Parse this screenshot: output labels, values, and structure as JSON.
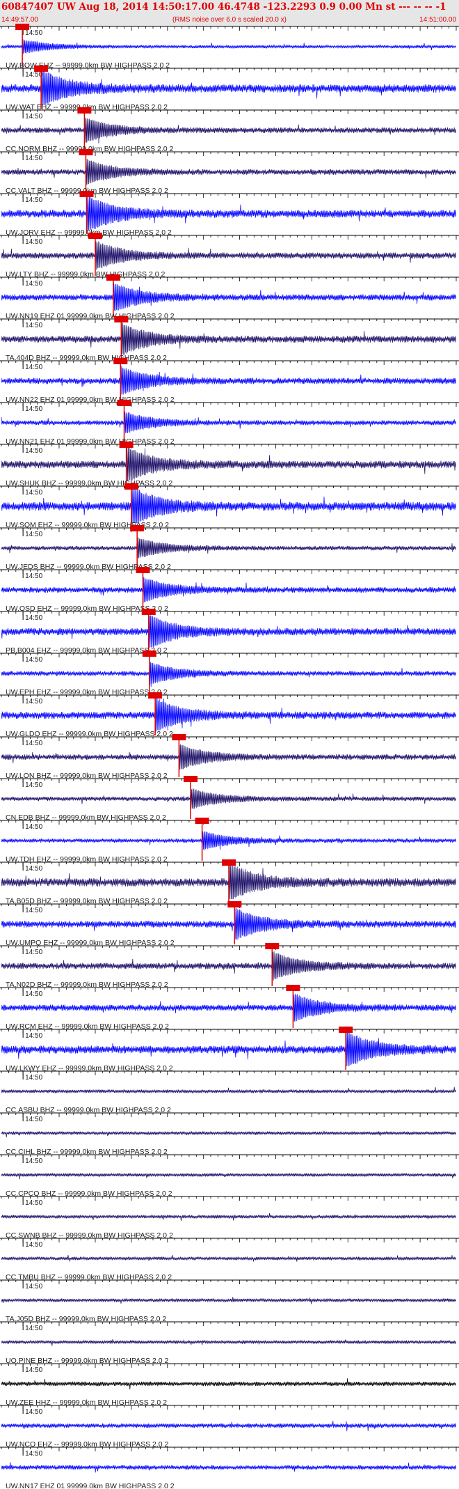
{
  "header": {
    "title": "60847407 UW Aug 18, 2014 14:50:17.00   46.4748 -123.2293  0.9 0.00 Mn st --- -- --  -1",
    "subtitle": "(RMS noise over 6.0 s scaled 20.0 x)",
    "start_time": "14:49:57.00",
    "end_time": "14:51:00.00"
  },
  "colors": {
    "header_bg": "#e6e6e6",
    "header_text": "#e00000",
    "pick": "#e00000",
    "trace_blue": "#0000ff",
    "trace_navy": "#1a0d66",
    "label": "#202020"
  },
  "minute_tick_label": "14:50",
  "chart_data": {
    "type": "line",
    "title": "60847407 UW Aug 18, 2014 14:50:17.00",
    "x_range": [
      "14:49:57.00",
      "14:51:00.00"
    ],
    "x_ticks": [
      "14:50"
    ],
    "series": [
      {
        "name": "UW.BOW EHZ -- 99999.0km BW  HIGHPASS  2.0  2",
        "color": "blue",
        "pick_time": "14:49:59.9",
        "level": 0.15
      },
      {
        "name": "UW.WAT EHZ -- 99999.0km BW  HIGHPASS  2.0  2",
        "color": "blue",
        "pick_time": "14:50:02.5",
        "level": 0.9
      },
      {
        "name": "CC.NORM BHZ -- 99999.0km BW  HIGHPASS  2.0  2",
        "color": "navy",
        "pick_time": "14:50:08.5",
        "level": 0.5
      },
      {
        "name": "CC.VALT BHZ -- 99999.0km BW  HIGHPASS  2.0  2",
        "color": "navy",
        "pick_time": "14:50:08.7",
        "level": 0.5
      },
      {
        "name": "UW.JORV EHZ -- 99999.0km BW  HIGHPASS  2.0  2",
        "color": "blue",
        "pick_time": "14:50:08.8",
        "level": 0.85
      },
      {
        "name": "UW.LTY BHZ -- 99999.0km BW  HIGHPASS  2.0  2",
        "color": "navy",
        "pick_time": "14:50:10.0",
        "level": 0.6
      },
      {
        "name": "UW.NN19 EHZ 01 99999.0km BW  HIGHPASS  2.0  2",
        "color": "blue",
        "pick_time": "14:50:12.5",
        "level": 0.6
      },
      {
        "name": "TA.404D BHZ -- 99999.0km BW  HIGHPASS  2.0  2",
        "color": "navy",
        "pick_time": "14:50:13.6",
        "level": 0.7
      },
      {
        "name": "UW.NN22 EHZ 01 99999.0km BW  HIGHPASS  2.0  2",
        "color": "blue",
        "pick_time": "14:50:13.5",
        "level": 0.6
      },
      {
        "name": "UW.NN21 EHZ 01 99999.0km BW  HIGHPASS  2.0  2",
        "color": "blue",
        "pick_time": "14:50:14.0",
        "level": 0.4
      },
      {
        "name": "UW.SHUK BHZ -- 99999.0km BW  HIGHPASS  2.0  2",
        "color": "navy",
        "pick_time": "14:50:14.3",
        "level": 0.8
      },
      {
        "name": "UW.SQM EHZ -- 99999.0km BW  HIGHPASS  2.0  2",
        "color": "blue",
        "pick_time": "14:50:15.0",
        "level": 0.95
      },
      {
        "name": "UW.JEDS BHZ -- 99999.0km BW  HIGHPASS  2.0  2",
        "color": "navy",
        "pick_time": "14:50:15.8",
        "level": 0.35
      },
      {
        "name": "UW.OSD EHZ -- 99999.0km BW  HIGHPASS  2.0  2",
        "color": "blue",
        "pick_time": "14:50:16.6",
        "level": 0.5
      },
      {
        "name": "PB.B004 EHZ -- 99999.0km BW  HIGHPASS  2.0  2",
        "color": "blue",
        "pick_time": "14:50:17.4",
        "level": 0.75
      },
      {
        "name": "UW.EPH EHZ -- 99999.0km BW  HIGHPASS  2.0  2",
        "color": "blue",
        "pick_time": "14:50:17.5",
        "level": 0.4
      },
      {
        "name": "UW.GLDO EHZ -- 99999.0km BW  HIGHPASS  2.0  2",
        "color": "blue",
        "pick_time": "14:50:18.3",
        "level": 0.75
      },
      {
        "name": "UW.LON BHZ -- 99999.0km BW  HIGHPASS  2.0  2",
        "color": "navy",
        "pick_time": "14:50:21.6",
        "level": 0.5
      },
      {
        "name": "CN.EDB BHZ -- 99999.0km BW  HIGHPASS  2.0  2",
        "color": "navy",
        "pick_time": "14:50:23.2",
        "level": 0.35
      },
      {
        "name": "UW.TDH EHZ -- 99999.0km BW  HIGHPASS  2.0  2",
        "color": "blue",
        "pick_time": "14:50:24.8",
        "level": 0.3
      },
      {
        "name": "TA.B05D BHZ -- 99999.0km BW  HIGHPASS  2.0  2",
        "color": "navy",
        "pick_time": "14:50:28.5",
        "level": 0.9
      },
      {
        "name": "UW.UMPQ EHZ -- 99999.0km BW  HIGHPASS  2.0  2",
        "color": "blue",
        "pick_time": "14:50:29.3",
        "level": 0.7
      },
      {
        "name": "TA.N02D BHZ -- 99999.0km BW  HIGHPASS  2.0  2",
        "color": "navy",
        "pick_time": "14:50:34.5",
        "level": 0.6
      },
      {
        "name": "UW.RCM EHZ -- 99999.0km BW  HIGHPASS  2.0  2",
        "color": "blue",
        "pick_time": "14:50:37.4",
        "level": 0.6
      },
      {
        "name": "UW.LKWY EHZ -- 99999.0km BW  HIGHPASS  2.0  2",
        "color": "blue",
        "pick_time": "14:50:44.7",
        "level": 0.85
      },
      {
        "name": "CC.ASBU BHZ -- 99999.0km BW  HIGHPASS  2.0  2",
        "color": "navy",
        "level": 0.2
      },
      {
        "name": "CC.CIHL BHZ -- 99999.0km BW  HIGHPASS  2.0  2",
        "color": "navy",
        "level": 0.2
      },
      {
        "name": "CC.CPCO BHZ -- 99999.0km BW  HIGHPASS  2.0  2",
        "color": "navy",
        "level": 0.2
      },
      {
        "name": "CC.SWNB BHZ -- 99999.0km BW  HIGHPASS  2.0  2",
        "color": "navy",
        "level": 0.2
      },
      {
        "name": "CC.TMBU BHZ -- 99999.0km BW  HIGHPASS  2.0  2",
        "color": "navy",
        "level": 0.2
      },
      {
        "name": "TA.J05D BHZ -- 99999.0km BW  HIGHPASS  2.0  2",
        "color": "navy",
        "level": 0.2
      },
      {
        "name": "UO.PINE BHZ -- 99999.0km BW  HIGHPASS  2.0  2",
        "color": "navy",
        "level": 0.2
      },
      {
        "name": "UW.ZEE HHZ -- 99999.0km BW  HIGHPASS  2.0  2",
        "color": "black",
        "level": 0.35
      },
      {
        "name": "UW.NCO EHZ -- 99999.0km BW  HIGHPASS  2.0  2",
        "color": "blue",
        "level": 0.35
      },
      {
        "name": "UW.NN17 EHZ 01 99999.0km BW  HIGHPASS  2.0  2",
        "color": "blue",
        "level": 0.35
      }
    ]
  }
}
